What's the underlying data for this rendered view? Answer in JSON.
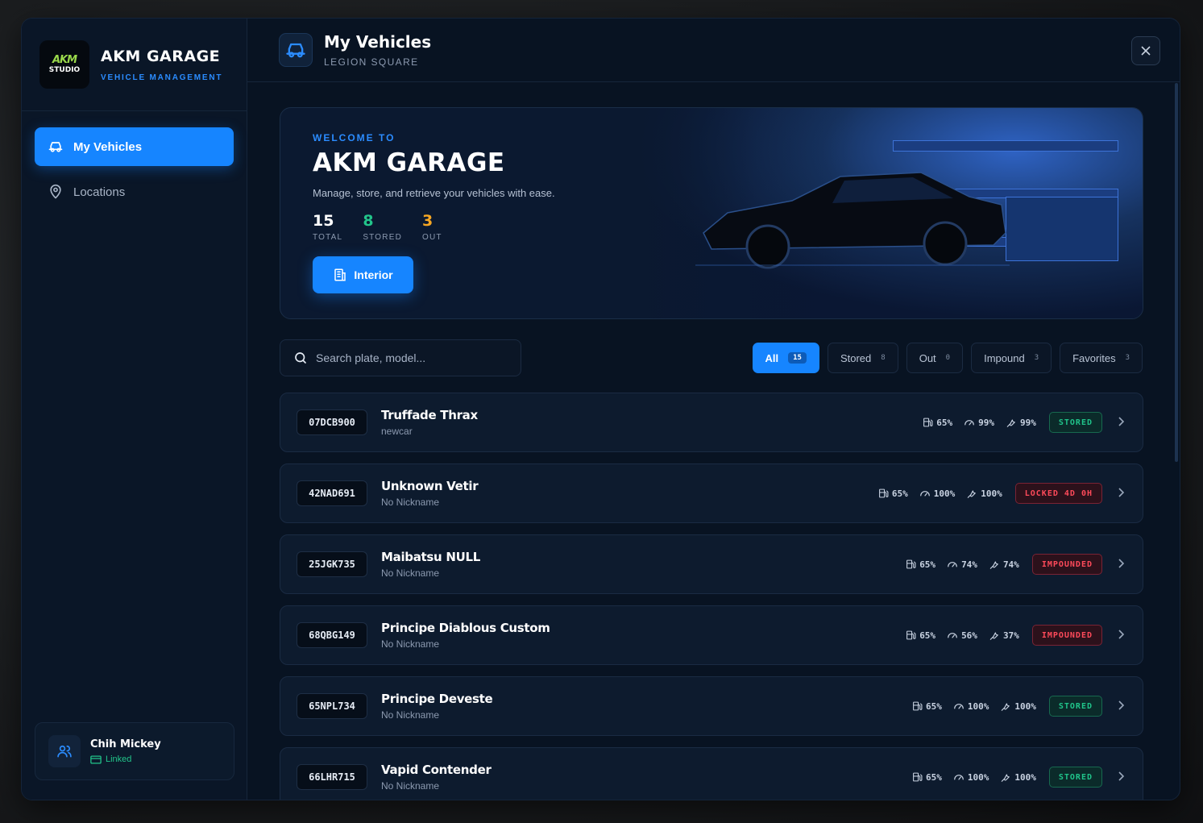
{
  "brand": {
    "logo_mark": "AKM",
    "logo_sub": "STUDIO",
    "title": "AKM GARAGE",
    "subtitle": "VEHICLE MANAGEMENT"
  },
  "nav": [
    {
      "label": "My Vehicles",
      "icon": "car-icon",
      "active": true
    },
    {
      "label": "Locations",
      "icon": "map-pin-icon",
      "active": false
    }
  ],
  "user": {
    "name": "Chih Mickey",
    "status": "Linked"
  },
  "header": {
    "title": "My Vehicles",
    "subtitle": "LEGION SQUARE"
  },
  "hero": {
    "welcome": "WELCOME TO",
    "title": "AKM GARAGE",
    "description": "Manage, store, and retrieve your vehicles with ease.",
    "stats": [
      {
        "value": "15",
        "label": "TOTAL",
        "color": "#ffffff"
      },
      {
        "value": "8",
        "label": "STORED",
        "color": "#22c48a"
      },
      {
        "value": "3",
        "label": "OUT",
        "color": "#f5a623"
      }
    ],
    "button": "Interior"
  },
  "search": {
    "placeholder": "Search plate, model..."
  },
  "filters": [
    {
      "label": "All",
      "count": "15"
    },
    {
      "label": "Stored",
      "count": "8"
    },
    {
      "label": "Out",
      "count": "0"
    },
    {
      "label": "Impound",
      "count": "3"
    },
    {
      "label": "Favorites",
      "count": "3"
    }
  ],
  "vehicles": [
    {
      "plate": "07DCB900",
      "name": "Truffade Thrax",
      "nickname": "newcar",
      "fuel": "65%",
      "engine": "99%",
      "body": "99%",
      "status": "STORED",
      "status_type": "stored"
    },
    {
      "plate": "42NAD691",
      "name": "Unknown Vetir",
      "nickname": "No Nickname",
      "fuel": "65%",
      "engine": "100%",
      "body": "100%",
      "status": "LOCKED 4D 0H",
      "status_type": "red"
    },
    {
      "plate": "25JGK735",
      "name": "Maibatsu NULL",
      "nickname": "No Nickname",
      "fuel": "65%",
      "engine": "74%",
      "body": "74%",
      "status": "IMPOUNDED",
      "status_type": "red"
    },
    {
      "plate": "68QBG149",
      "name": "Principe Diablous Custom",
      "nickname": "No Nickname",
      "fuel": "65%",
      "engine": "56%",
      "body": "37%",
      "status": "IMPOUNDED",
      "status_type": "red"
    },
    {
      "plate": "65NPL734",
      "name": "Principe Deveste",
      "nickname": "No Nickname",
      "fuel": "65%",
      "engine": "100%",
      "body": "100%",
      "status": "STORED",
      "status_type": "stored"
    },
    {
      "plate": "66LHR715",
      "name": "Vapid Contender",
      "nickname": "No Nickname",
      "fuel": "65%",
      "engine": "100%",
      "body": "100%",
      "status": "STORED",
      "status_type": "stored"
    }
  ]
}
